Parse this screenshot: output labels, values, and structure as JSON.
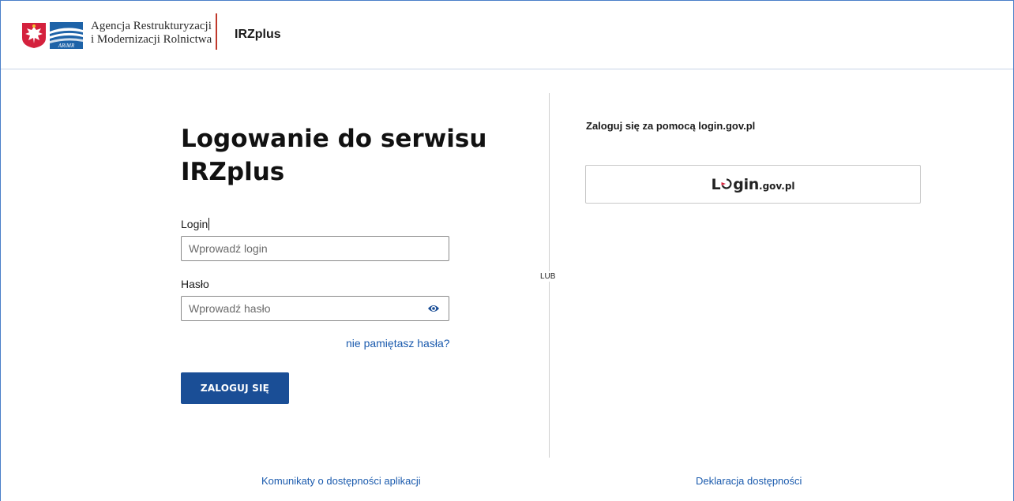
{
  "header": {
    "agency_line1": "Agencja Restrukturyzacji",
    "agency_line2": "i Modernizacji Rolnictwa",
    "arimr_mark": "ARiMR",
    "app_name": "IRZplus"
  },
  "login_form": {
    "title_line1": "Logowanie do serwisu",
    "title_line2": "IRZplus",
    "login_label": "Login",
    "login_placeholder": "Wprowadź login",
    "password_label": "Hasło",
    "password_placeholder": "Wprowadź hasło",
    "show_password_icon": "eye-icon",
    "forgot_password": "nie pamiętasz hasła?",
    "submit_label": "ZALOGUJ SIĘ"
  },
  "separator": "LUB",
  "gov_login": {
    "heading": "Zaloguj się za pomocą login.gov.pl",
    "logo_L": "L",
    "logo_gin": "gin",
    "logo_suffix": ".gov.pl"
  },
  "footer": {
    "left_link": "Komunikaty o dostępności aplikacji",
    "right_link": "Deklaracja dostępności"
  },
  "colors": {
    "primary_button": "#1a4e96",
    "link": "#1a5aad",
    "header_divider": "#c0392b",
    "gov_arrow": "#d6203a"
  }
}
